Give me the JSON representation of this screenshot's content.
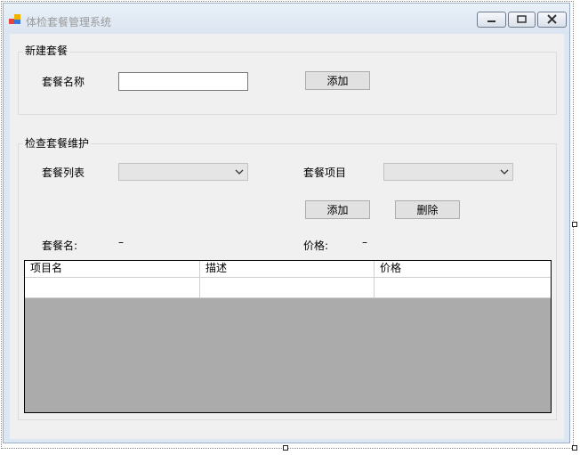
{
  "window": {
    "title": "体检套餐管理系统"
  },
  "new_package": {
    "group_title": "新建套餐",
    "name_label": "套餐名称",
    "name_value": "",
    "add_button": "添加"
  },
  "maintenance": {
    "group_title": "检查套餐维护",
    "package_list_label": "套餐列表",
    "package_list_value": "",
    "package_item_label": "套餐项目",
    "package_item_value": "",
    "add_button": "添加",
    "delete_button": "删除",
    "package_name_label": "套餐名:",
    "package_name_value": "–",
    "price_label": "价格:",
    "price_value": "–"
  },
  "grid": {
    "columns": [
      "项目名",
      "描述",
      "价格"
    ],
    "rows": [
      [
        "",
        "",
        ""
      ]
    ]
  }
}
